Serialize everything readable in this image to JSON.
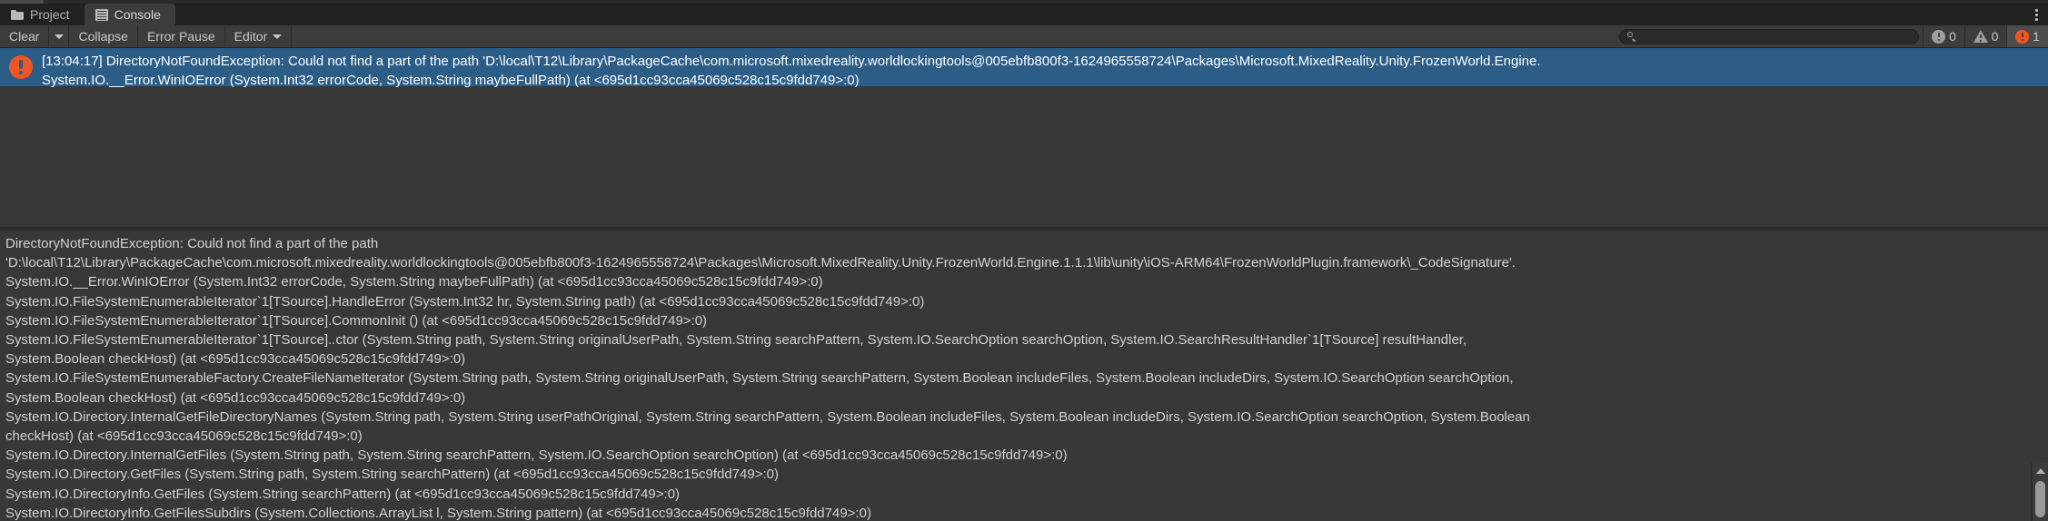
{
  "window": {
    "title": "Console"
  },
  "tabs": [
    {
      "label": "Project",
      "icon": "folder-icon",
      "active": false
    },
    {
      "label": "Console",
      "icon": "console-icon",
      "active": true
    }
  ],
  "tabbar": {
    "kebab_icon": "kebab-menu-icon"
  },
  "toolbar": {
    "clear_label": "Clear",
    "clear_dropdown_icon": "chevron-down-icon",
    "collapse_label": "Collapse",
    "error_pause_label": "Error Pause",
    "editor_label": "Editor",
    "editor_dropdown_icon": "chevron-down-icon",
    "search": {
      "icon": "search-icon",
      "value": "",
      "placeholder": ""
    },
    "counters": {
      "info": {
        "icon": "info-badge-icon",
        "count": "0",
        "active": false
      },
      "warning": {
        "icon": "warning-badge-icon",
        "count": "0",
        "active": false
      },
      "error": {
        "icon": "error-badge-icon",
        "count": "1",
        "active": true
      }
    }
  },
  "log_entries": [
    {
      "icon": "error-icon",
      "selected": true,
      "line1": "[13:04:17] DirectoryNotFoundException: Could not find a part of the path 'D:\\local\\T12\\Library\\PackageCache\\com.microsoft.mixedreality.worldlockingtools@005ebfb800f3-1624965558724\\Packages\\Microsoft.MixedReality.Unity.FrozenWorld.Engine.",
      "line2": "System.IO.__Error.WinIOError (System.Int32 errorCode, System.String maybeFullPath) (at <695d1cc93cca45069c528c15c9fdd749>:0)"
    }
  ],
  "detail": {
    "lines": [
      "DirectoryNotFoundException: Could not find a part of the path",
      "'D:\\local\\T12\\Library\\PackageCache\\com.microsoft.mixedreality.worldlockingtools@005ebfb800f3-1624965558724\\Packages\\Microsoft.MixedReality.Unity.FrozenWorld.Engine.1.1.1\\lib\\unity\\iOS-ARM64\\FrozenWorldPlugin.framework\\_CodeSignature'.",
      "System.IO.__Error.WinIOError (System.Int32 errorCode, System.String maybeFullPath) (at <695d1cc93cca45069c528c15c9fdd749>:0)",
      "System.IO.FileSystemEnumerableIterator`1[TSource].HandleError (System.Int32 hr, System.String path) (at <695d1cc93cca45069c528c15c9fdd749>:0)",
      "System.IO.FileSystemEnumerableIterator`1[TSource].CommonInit () (at <695d1cc93cca45069c528c15c9fdd749>:0)",
      "System.IO.FileSystemEnumerableIterator`1[TSource]..ctor (System.String path, System.String originalUserPath, System.String searchPattern, System.IO.SearchOption searchOption, System.IO.SearchResultHandler`1[TSource] resultHandler,",
      "System.Boolean checkHost) (at <695d1cc93cca45069c528c15c9fdd749>:0)",
      "System.IO.FileSystemEnumerableFactory.CreateFileNameIterator (System.String path, System.String originalUserPath, System.String searchPattern, System.Boolean includeFiles, System.Boolean includeDirs, System.IO.SearchOption searchOption,",
      "System.Boolean checkHost) (at <695d1cc93cca45069c528c15c9fdd749>:0)",
      "System.IO.Directory.InternalGetFileDirectoryNames (System.String path, System.String userPathOriginal, System.String searchPattern, System.Boolean includeFiles, System.Boolean includeDirs, System.IO.SearchOption searchOption, System.Boolean",
      "checkHost) (at <695d1cc93cca45069c528c15c9fdd749>:0)",
      "System.IO.Directory.InternalGetFiles (System.String path, System.String searchPattern, System.IO.SearchOption searchOption) (at <695d1cc93cca45069c528c15c9fdd749>:0)",
      "System.IO.Directory.GetFiles (System.String path, System.String searchPattern) (at <695d1cc93cca45069c528c15c9fdd749>:0)",
      "System.IO.DirectoryInfo.GetFiles (System.String searchPattern) (at <695d1cc93cca45069c528c15c9fdd749>:0)",
      "System.IO.DirectoryInfo.GetFilesSubdirs (System.Collections.ArrayList l, System.String pattern) (at <695d1cc93cca45069c528c15c9fdd749>:0)"
    ],
    "scrollbar": {
      "up_arrow_icon": "scroll-up-arrow-icon"
    }
  },
  "colors": {
    "background": "#383838",
    "selection": "#2c5d87",
    "error_accent": "#f15523",
    "toolbar": "#3c3c3c",
    "tabbar": "#21211f"
  }
}
